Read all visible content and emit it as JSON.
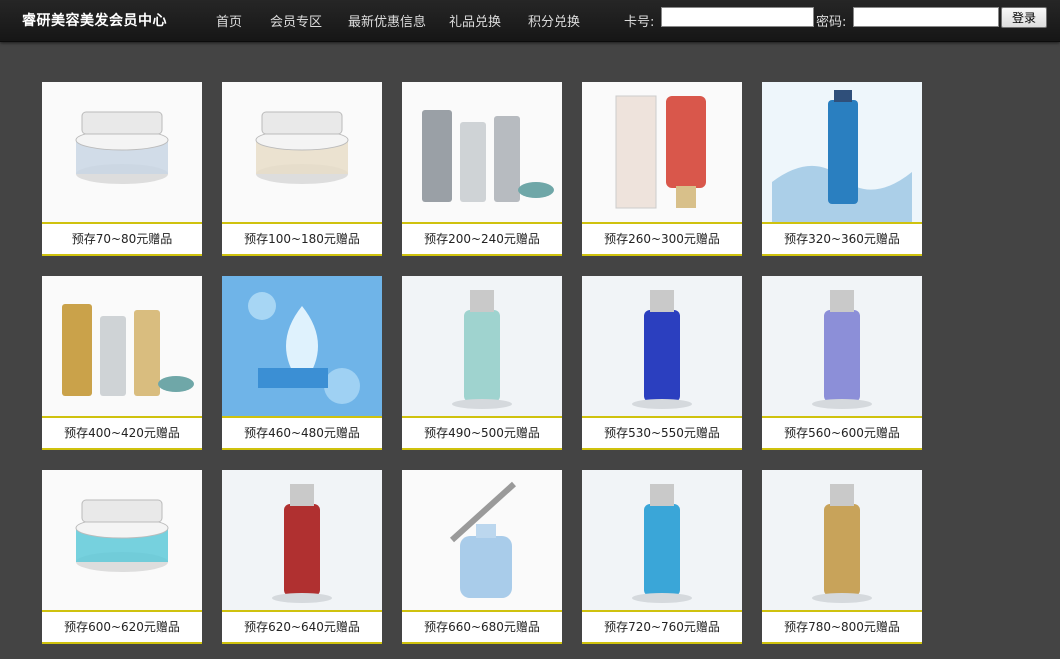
{
  "header": {
    "title": "睿研美容美发会员中心",
    "nav": [
      "首页",
      "会员专区",
      "最新优惠信息",
      "礼品兑换",
      "积分兑换"
    ],
    "card_label": "卡号:",
    "password_label": "密码:",
    "card_value": "",
    "password_value": "",
    "login_button": "登录"
  },
  "products": [
    {
      "caption": "预存70~80元赠品",
      "icon": "cream-jar-box-photo",
      "accent": "#c9d6e4"
    },
    {
      "caption": "预存100~180元赠品",
      "icon": "cream-jar-photo",
      "accent": "#e8ddc8"
    },
    {
      "caption": "预存200~240元赠品",
      "icon": "skincare-set-photo",
      "accent": "#9aa0a6"
    },
    {
      "caption": "预存260~300元赠品",
      "icon": "tube-bottle-photo",
      "accent": "#d9574b"
    },
    {
      "caption": "预存320~360元赠品",
      "icon": "blue-bottle-splash-photo",
      "accent": "#2a7fc0"
    },
    {
      "caption": "预存400~420元赠品",
      "icon": "gift-box-set-photo",
      "accent": "#caa24a"
    },
    {
      "caption": "预存460~480元赠品",
      "icon": "alga-mask-photo",
      "accent": "#3b8fd4"
    },
    {
      "caption": "预存490~500元赠品",
      "icon": "ciro-bottle-photo",
      "accent": "#9fd3cf"
    },
    {
      "caption": "预存530~550元赠品",
      "icon": "blue-serum-photo",
      "accent": "#2b3fbf"
    },
    {
      "caption": "预存560~600元赠品",
      "icon": "pump-bottle-book-photo",
      "accent": "#8c8fd8"
    },
    {
      "caption": "预存600~620元赠品",
      "icon": "gel-jar-photo",
      "accent": "#5ec9d8"
    },
    {
      "caption": "预存620~640元赠品",
      "icon": "red-bottle-photo",
      "accent": "#b03030"
    },
    {
      "caption": "预存660~680元赠品",
      "icon": "dropper-bottle-photo",
      "accent": "#9ac3e6"
    },
    {
      "caption": "预存720~760元赠品",
      "icon": "pump-bottle-splash-photo",
      "accent": "#3aa6d8"
    },
    {
      "caption": "预存780~800元赠品",
      "icon": "oleva-bottle-photo",
      "accent": "#c8a35a"
    }
  ]
}
